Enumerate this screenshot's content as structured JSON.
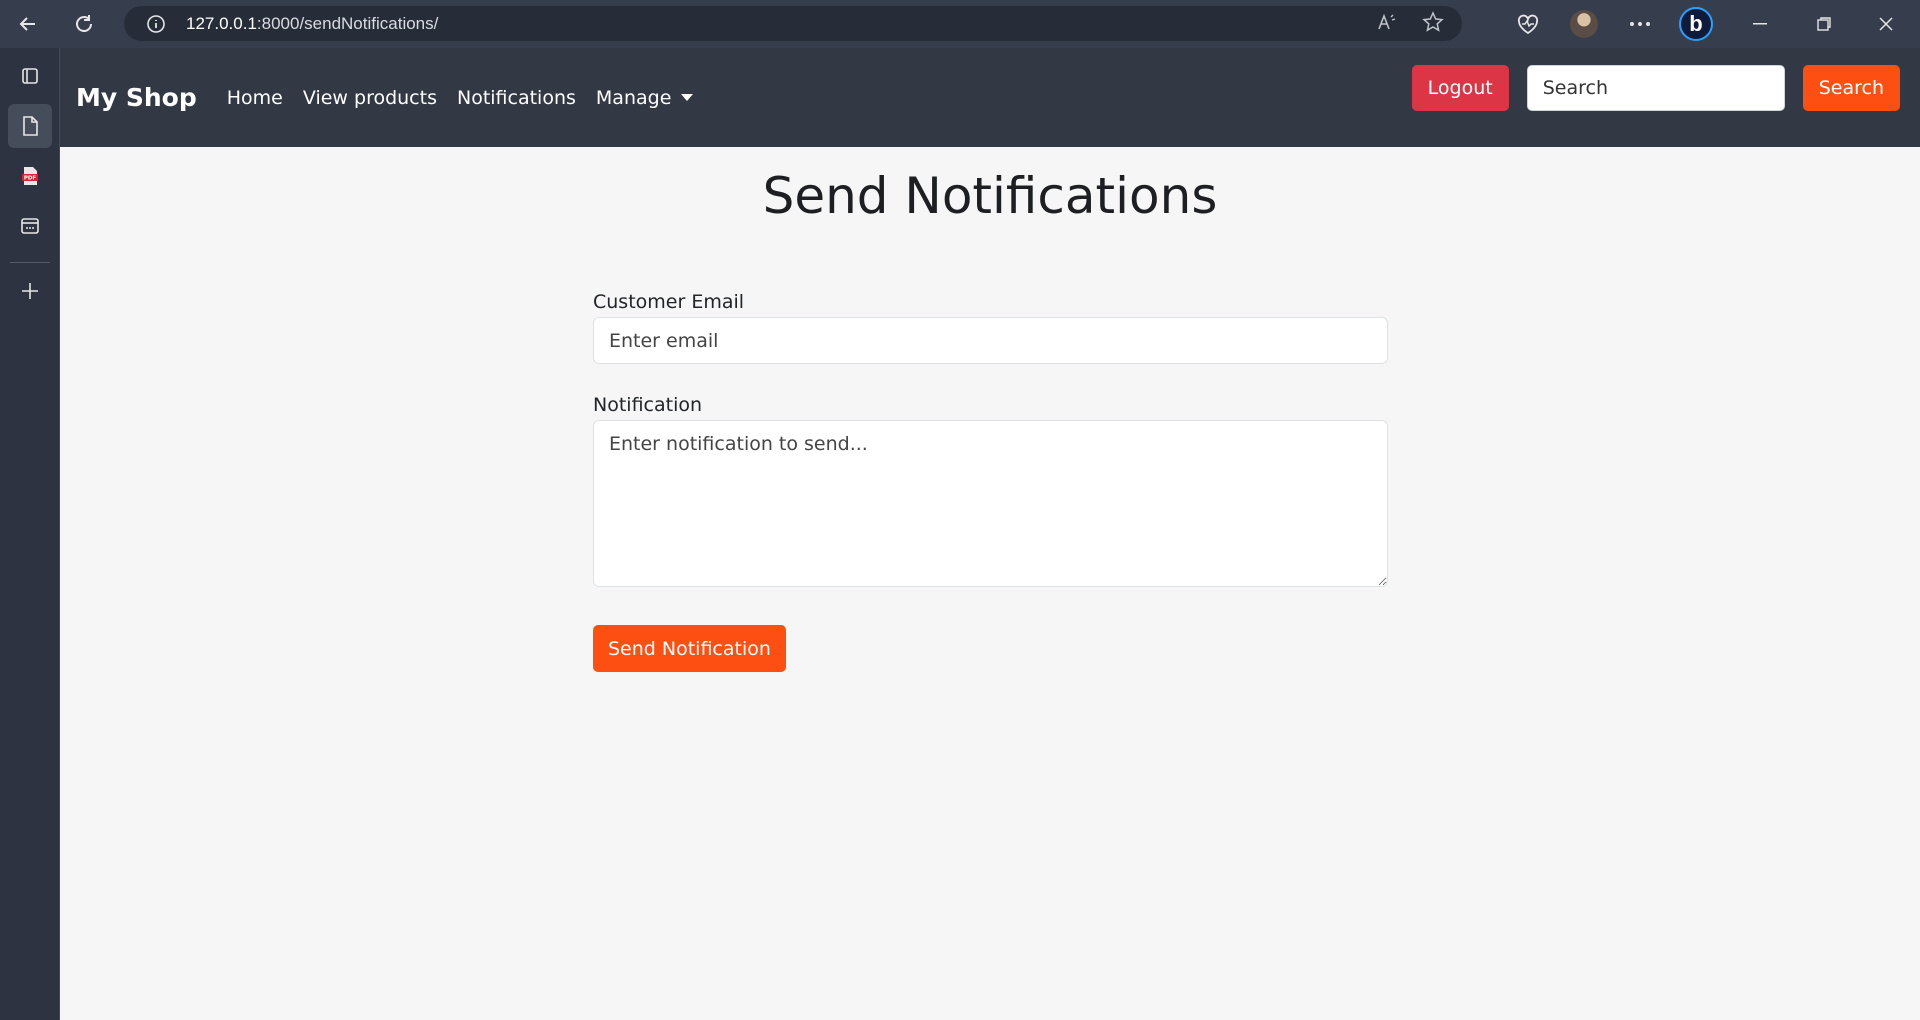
{
  "browser": {
    "url_host": "127.0.0.1",
    "url_path": ":8000/sendNotifications/",
    "read_aloud_label": "Â"
  },
  "navbar": {
    "brand": "My Shop",
    "links": [
      "Home",
      "View products",
      "Notifications",
      "Manage"
    ],
    "logout_label": "Logout",
    "search_placeholder": "Search",
    "search_button_label": "Search"
  },
  "main": {
    "title": "Send Notifications",
    "email_label": "Customer Email",
    "email_placeholder": "Enter email",
    "notification_label": "Notification",
    "notification_placeholder": "Enter notification to send...",
    "send_button_label": "Send Notification"
  },
  "colors": {
    "navbar_bg": "#323844",
    "accent_orange": "#fd4f12",
    "danger_red": "#dc3545",
    "page_bg": "#f6f6f6"
  }
}
